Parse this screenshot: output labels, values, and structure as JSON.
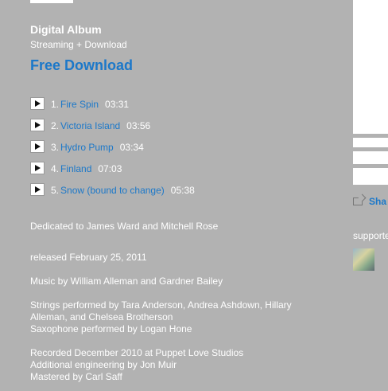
{
  "album": {
    "format_title": "Digital Album",
    "format_sub": "Streaming + Download",
    "free_download": "Free Download"
  },
  "tracks": [
    {
      "num": "1.",
      "title": "Fire Spin",
      "duration": "03:31"
    },
    {
      "num": "2.",
      "title": "Victoria Island",
      "duration": "03:56"
    },
    {
      "num": "3.",
      "title": "Hydro Pump",
      "duration": "03:34"
    },
    {
      "num": "4.",
      "title": "Finland",
      "duration": "07:03"
    },
    {
      "num": "5.",
      "title": "Snow (bound to change)",
      "duration": "05:38"
    }
  ],
  "credits": {
    "dedication": "Dedicated to James Ward and Mitchell Rose",
    "released": "released February 25, 2011",
    "music_by": "Music by William Alleman and Gardner Bailey",
    "strings": "Strings performed by Tara Anderson, Andrea Ashdown, Hillary Alleman, and Chelsea Brotherson",
    "saxophone": "Saxophone performed by Logan Hone",
    "recorded": "Recorded December 2010 at Puppet Love Studios",
    "engineering": "Additional engineering by Jon Muir",
    "mastered": "Mastered by Carl Saff"
  },
  "sidebar": {
    "share_label": "Sha",
    "supported_label": "supporte"
  },
  "colors": {
    "background": "#b2b2b2",
    "link": "#1c78c9",
    "text": "#ffffff"
  }
}
